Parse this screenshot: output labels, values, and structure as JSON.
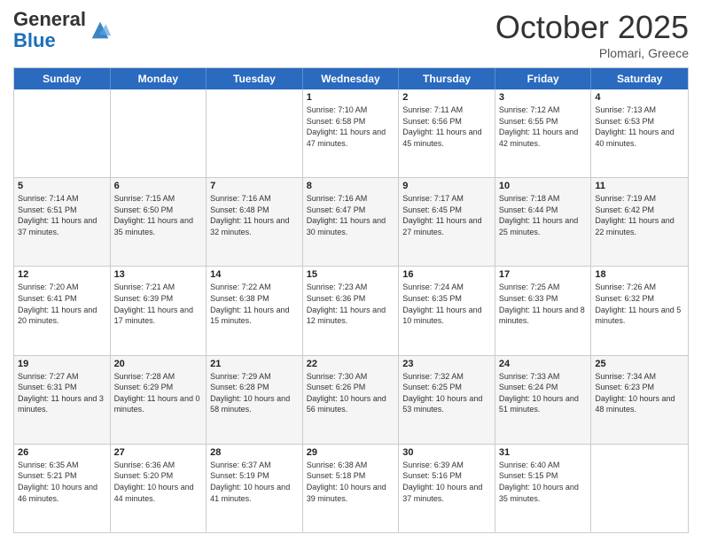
{
  "header": {
    "logo_general": "General",
    "logo_blue": "Blue",
    "month": "October 2025",
    "location": "Plomari, Greece"
  },
  "days_of_week": [
    "Sunday",
    "Monday",
    "Tuesday",
    "Wednesday",
    "Thursday",
    "Friday",
    "Saturday"
  ],
  "weeks": [
    [
      {
        "day": "",
        "info": ""
      },
      {
        "day": "",
        "info": ""
      },
      {
        "day": "",
        "info": ""
      },
      {
        "day": "1",
        "info": "Sunrise: 7:10 AM\nSunset: 6:58 PM\nDaylight: 11 hours and 47 minutes."
      },
      {
        "day": "2",
        "info": "Sunrise: 7:11 AM\nSunset: 6:56 PM\nDaylight: 11 hours and 45 minutes."
      },
      {
        "day": "3",
        "info": "Sunrise: 7:12 AM\nSunset: 6:55 PM\nDaylight: 11 hours and 42 minutes."
      },
      {
        "day": "4",
        "info": "Sunrise: 7:13 AM\nSunset: 6:53 PM\nDaylight: 11 hours and 40 minutes."
      }
    ],
    [
      {
        "day": "5",
        "info": "Sunrise: 7:14 AM\nSunset: 6:51 PM\nDaylight: 11 hours and 37 minutes."
      },
      {
        "day": "6",
        "info": "Sunrise: 7:15 AM\nSunset: 6:50 PM\nDaylight: 11 hours and 35 minutes."
      },
      {
        "day": "7",
        "info": "Sunrise: 7:16 AM\nSunset: 6:48 PM\nDaylight: 11 hours and 32 minutes."
      },
      {
        "day": "8",
        "info": "Sunrise: 7:16 AM\nSunset: 6:47 PM\nDaylight: 11 hours and 30 minutes."
      },
      {
        "day": "9",
        "info": "Sunrise: 7:17 AM\nSunset: 6:45 PM\nDaylight: 11 hours and 27 minutes."
      },
      {
        "day": "10",
        "info": "Sunrise: 7:18 AM\nSunset: 6:44 PM\nDaylight: 11 hours and 25 minutes."
      },
      {
        "day": "11",
        "info": "Sunrise: 7:19 AM\nSunset: 6:42 PM\nDaylight: 11 hours and 22 minutes."
      }
    ],
    [
      {
        "day": "12",
        "info": "Sunrise: 7:20 AM\nSunset: 6:41 PM\nDaylight: 11 hours and 20 minutes."
      },
      {
        "day": "13",
        "info": "Sunrise: 7:21 AM\nSunset: 6:39 PM\nDaylight: 11 hours and 17 minutes."
      },
      {
        "day": "14",
        "info": "Sunrise: 7:22 AM\nSunset: 6:38 PM\nDaylight: 11 hours and 15 minutes."
      },
      {
        "day": "15",
        "info": "Sunrise: 7:23 AM\nSunset: 6:36 PM\nDaylight: 11 hours and 12 minutes."
      },
      {
        "day": "16",
        "info": "Sunrise: 7:24 AM\nSunset: 6:35 PM\nDaylight: 11 hours and 10 minutes."
      },
      {
        "day": "17",
        "info": "Sunrise: 7:25 AM\nSunset: 6:33 PM\nDaylight: 11 hours and 8 minutes."
      },
      {
        "day": "18",
        "info": "Sunrise: 7:26 AM\nSunset: 6:32 PM\nDaylight: 11 hours and 5 minutes."
      }
    ],
    [
      {
        "day": "19",
        "info": "Sunrise: 7:27 AM\nSunset: 6:31 PM\nDaylight: 11 hours and 3 minutes."
      },
      {
        "day": "20",
        "info": "Sunrise: 7:28 AM\nSunset: 6:29 PM\nDaylight: 11 hours and 0 minutes."
      },
      {
        "day": "21",
        "info": "Sunrise: 7:29 AM\nSunset: 6:28 PM\nDaylight: 10 hours and 58 minutes."
      },
      {
        "day": "22",
        "info": "Sunrise: 7:30 AM\nSunset: 6:26 PM\nDaylight: 10 hours and 56 minutes."
      },
      {
        "day": "23",
        "info": "Sunrise: 7:32 AM\nSunset: 6:25 PM\nDaylight: 10 hours and 53 minutes."
      },
      {
        "day": "24",
        "info": "Sunrise: 7:33 AM\nSunset: 6:24 PM\nDaylight: 10 hours and 51 minutes."
      },
      {
        "day": "25",
        "info": "Sunrise: 7:34 AM\nSunset: 6:23 PM\nDaylight: 10 hours and 48 minutes."
      }
    ],
    [
      {
        "day": "26",
        "info": "Sunrise: 6:35 AM\nSunset: 5:21 PM\nDaylight: 10 hours and 46 minutes."
      },
      {
        "day": "27",
        "info": "Sunrise: 6:36 AM\nSunset: 5:20 PM\nDaylight: 10 hours and 44 minutes."
      },
      {
        "day": "28",
        "info": "Sunrise: 6:37 AM\nSunset: 5:19 PM\nDaylight: 10 hours and 41 minutes."
      },
      {
        "day": "29",
        "info": "Sunrise: 6:38 AM\nSunset: 5:18 PM\nDaylight: 10 hours and 39 minutes."
      },
      {
        "day": "30",
        "info": "Sunrise: 6:39 AM\nSunset: 5:16 PM\nDaylight: 10 hours and 37 minutes."
      },
      {
        "day": "31",
        "info": "Sunrise: 6:40 AM\nSunset: 5:15 PM\nDaylight: 10 hours and 35 minutes."
      },
      {
        "day": "",
        "info": ""
      }
    ]
  ]
}
